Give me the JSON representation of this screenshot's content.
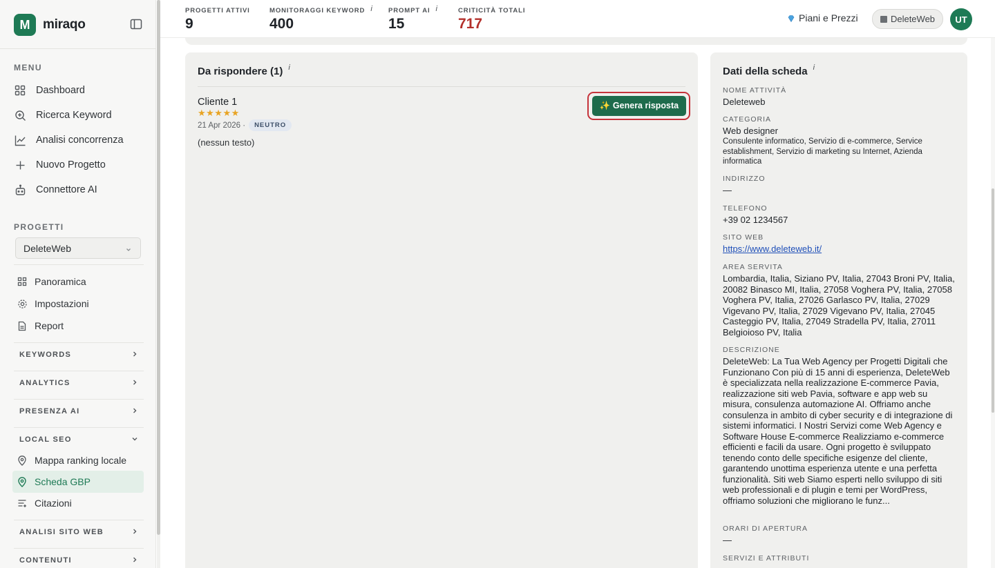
{
  "brand": {
    "name": "miraqo",
    "logo_letter": "M"
  },
  "sidebar": {
    "menu_title": "MENU",
    "menu": [
      {
        "label": "Dashboard",
        "icon": "grid-icon"
      },
      {
        "label": "Ricerca Keyword",
        "icon": "search-icon"
      },
      {
        "label": "Analisi concorrenza",
        "icon": "chart-line-icon"
      },
      {
        "label": "Nuovo Progetto",
        "icon": "plus-icon"
      },
      {
        "label": "Connettore AI",
        "icon": "robot-icon"
      }
    ],
    "projects_title": "PROGETTI",
    "project_select": "DeleteWeb",
    "project_items": [
      {
        "label": "Panoramica",
        "icon": "grid-icon"
      },
      {
        "label": "Impostazioni",
        "icon": "gear-icon"
      },
      {
        "label": "Report",
        "icon": "document-icon"
      }
    ],
    "groups": {
      "keywords": "KEYWORDS",
      "analytics": "ANALYTICS",
      "ai_presence": "PRESENZA AI",
      "local_seo": "LOCAL SEO",
      "site_analysis": "ANALISI SITO WEB",
      "contents": "CONTENUTI"
    },
    "local_seo_items": [
      {
        "label": "Mappa ranking locale",
        "icon": "map-pin-icon"
      },
      {
        "label": "Scheda GBP",
        "icon": "map-pin-icon",
        "active": true
      },
      {
        "label": "Citazioni",
        "icon": "list-icon"
      }
    ]
  },
  "header": {
    "stats": [
      {
        "label": "PROGETTI ATTIVI",
        "value": "9",
        "info": ""
      },
      {
        "label": "MONITORAGGI KEYWORD",
        "value": "400",
        "info": "i"
      },
      {
        "label": "PROMPT AI",
        "value": "15",
        "info": "i"
      },
      {
        "label": "CRITICITÀ TOTALI",
        "value": "717",
        "info": ""
      }
    ],
    "plans_label": "Piani e Prezzi",
    "project_chip": "DeleteWeb",
    "avatar_initials": "UT"
  },
  "reviews": {
    "title": "Da rispondere (1)",
    "info": "i",
    "items": [
      {
        "author": "Cliente 1",
        "stars": "★★★★★",
        "date": "21 Apr 2026 ·",
        "sentiment": "NEUTRO",
        "text": "(nessun testo)",
        "button": "✨ Genera risposta"
      }
    ]
  },
  "profile": {
    "title": "Dati della scheda",
    "info": "i",
    "fields": {
      "name_label": "NOME ATTIVITÀ",
      "name": "Deleteweb",
      "category_label": "CATEGORIA",
      "category_main": "Web designer",
      "category_extra": "Consulente informatico, Servizio di e-commerce, Service establishment, Servizio di marketing su Internet, Azienda informatica",
      "address_label": "INDIRIZZO",
      "address": "—",
      "phone_label": "TELEFONO",
      "phone": "+39 02 1234567",
      "website_label": "SITO WEB",
      "website": "https://www.deleteweb.it/",
      "area_label": "AREA SERVITA",
      "area": "Lombardia, Italia, Siziano PV, Italia, 27043 Broni PV, Italia, 20082 Binasco MI, Italia, 27058 Voghera PV, Italia, 27058 Voghera PV, Italia, 27026 Garlasco PV, Italia, 27029 Vigevano PV, Italia, 27029 Vigevano PV, Italia, 27045 Casteggio PV, Italia, 27049 Stradella PV, Italia, 27011 Belgioioso PV, Italia",
      "description_label": "DESCRIZIONE",
      "description": "DeleteWeb: La Tua Web Agency per Progetti Digitali che Funzionano Con più di 15 anni di esperienza, DeleteWeb è specializzata nella realizzazione E-commerce Pavia, realizzazione siti web Pavia, software e app web su misura, consulenza automazione AI. Offriamo anche consulenza in ambito di cyber security e di integrazione di sistemi informatici. I Nostri Servizi come Web Agency e Software House E-commerce Realizziamo e-commerce efficienti e facili da usare. Ogni progetto è sviluppato tenendo conto delle specifiche esigenze del cliente, garantendo unottima esperienza utente e una perfetta funzionalità. Siti web Siamo esperti nello sviluppo di siti web professionali e di plugin e temi per WordPress, offriamo soluzioni che migliorano le funz...",
      "hours_label": "ORARI DI APERTURA",
      "hours": "—",
      "services_label": "SERVIZI E ATTRIBUTI"
    }
  },
  "colors": {
    "brand": "#1e7a55",
    "critical": "#b3302b",
    "highlight": "#c5323a"
  }
}
